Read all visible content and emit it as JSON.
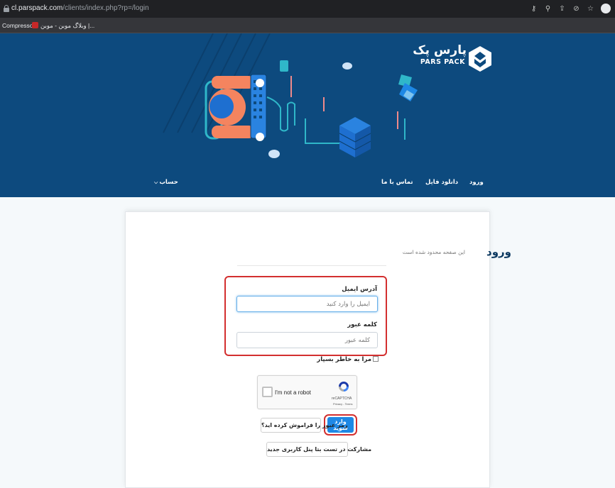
{
  "browser": {
    "url_host": "cl.parspack.com",
    "url_path": "/clients/index.php?rp=/login",
    "bookmarks": [
      "Compressor",
      "وبلاگ موبن - موبن |..."
    ]
  },
  "brand": {
    "name_fa": "پارس پک",
    "name_en": "PARS PACK",
    "color": "#0d4a7e"
  },
  "nav": {
    "login": "ورود",
    "file_download": "دانلود فایل",
    "contact_us": "تماس با ما",
    "account": "حساب"
  },
  "login": {
    "title": "ورود",
    "subtitle": "این صفحه محدود شده است",
    "email_label": "آدرس ایمیل",
    "email_placeholder": "ایمیل را وارد کنید",
    "password_label": "کلمه عبور",
    "password_placeholder": "کلمه عبور",
    "remember_label": "مرا به خاطر بسپار",
    "submit_label": "وارد شوید",
    "forgot_label": "رمز عبور را فراموش کرده اید؟",
    "beta_label": "مشارکت در تست بتا پنل کاربری جدید"
  },
  "recaptcha": {
    "label": "I'm not a robot",
    "brand": "reCAPTCHA",
    "links": "Privacy - Terms"
  },
  "colors": {
    "highlight": "#d32f2f",
    "primary_button": "#1e88e5"
  }
}
